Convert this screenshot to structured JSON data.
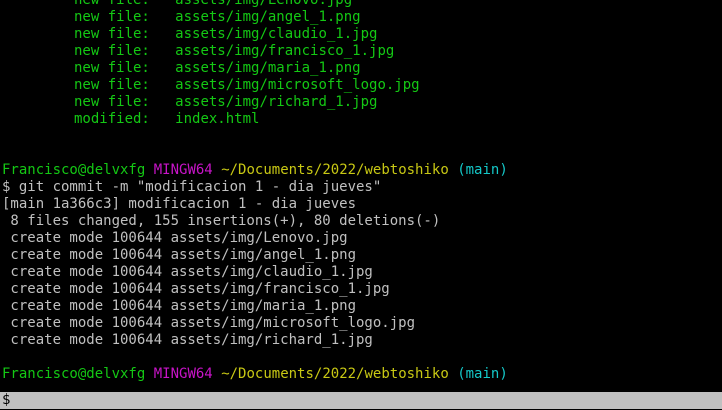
{
  "status_lines": [
    {
      "kind": "new file:",
      "path": "assets/img/Lenovo.jpg"
    },
    {
      "kind": "new file:",
      "path": "assets/img/angel_1.png"
    },
    {
      "kind": "new file:",
      "path": "assets/img/claudio_1.jpg"
    },
    {
      "kind": "new file:",
      "path": "assets/img/francisco_1.jpg"
    },
    {
      "kind": "new file:",
      "path": "assets/img/maria_1.png"
    },
    {
      "kind": "new file:",
      "path": "assets/img/microsoft_logo.jpg"
    },
    {
      "kind": "new file:",
      "path": "assets/img/richard_1.jpg"
    },
    {
      "kind": "modified:",
      "path": "index.html"
    }
  ],
  "prompt": {
    "user_host": "Francisco@delvxfg",
    "env": "MINGW64",
    "cwd": "~/Documents/2022/webtoshiko",
    "branch": "(main)"
  },
  "command": "$ git commit -m \"modificacion 1 - dia jueves\"",
  "commit_summary": "[main 1a366c3] modificacion 1 - dia jueves",
  "changes_summary": " 8 files changed, 155 insertions(+), 80 deletions(-)",
  "create_lines": [
    " create mode 100644 assets/img/Lenovo.jpg",
    " create mode 100644 assets/img/angel_1.png",
    " create mode 100644 assets/img/claudio_1.jpg",
    " create mode 100644 assets/img/francisco_1.jpg",
    " create mode 100644 assets/img/maria_1.png",
    " create mode 100644 assets/img/microsoft_logo.jpg",
    " create mode 100644 assets/img/richard_1.jpg"
  ],
  "input_prompt": "$",
  "colors": {
    "green": "#14c814",
    "magenta": "#c814c8",
    "yellow": "#c8c814",
    "cyan": "#14c8c8",
    "text": "#c0c0c0",
    "background": "#000000"
  }
}
